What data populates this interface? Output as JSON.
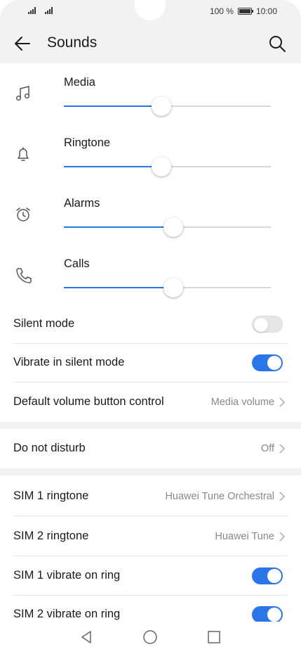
{
  "status_bar": {
    "battery_text": "100 %",
    "time": "10:00"
  },
  "header": {
    "title": "Sounds",
    "back_icon": "arrow-left-icon",
    "search_icon": "search-icon"
  },
  "volumes": [
    {
      "label": "Media",
      "icon": "music-note-icon",
      "level": 0.47
    },
    {
      "label": "Ringtone",
      "icon": "bell-icon",
      "level": 0.47
    },
    {
      "label": "Alarms",
      "icon": "alarm-clock-icon",
      "level": 0.53
    },
    {
      "label": "Calls",
      "icon": "phone-icon",
      "level": 0.53
    }
  ],
  "settings": {
    "silent_mode": {
      "label": "Silent mode",
      "on": false
    },
    "vibrate_silent": {
      "label": "Vibrate in silent mode",
      "on": true
    },
    "default_volume": {
      "label": "Default volume button control",
      "value": "Media volume"
    },
    "dnd": {
      "label": "Do not disturb",
      "value": "Off"
    },
    "sim1_ringtone": {
      "label": "SIM 1 ringtone",
      "value": "Huawei Tune Orchestral"
    },
    "sim2_ringtone": {
      "label": "SIM 2 ringtone",
      "value": "Huawei Tune"
    },
    "sim1_vibrate": {
      "label": "SIM 1 vibrate on ring",
      "on": true
    },
    "sim2_vibrate": {
      "label": "SIM 2 vibrate on ring",
      "on": true
    }
  },
  "colors": {
    "accent": "#2a76e8",
    "background": "#f2f2f2"
  }
}
